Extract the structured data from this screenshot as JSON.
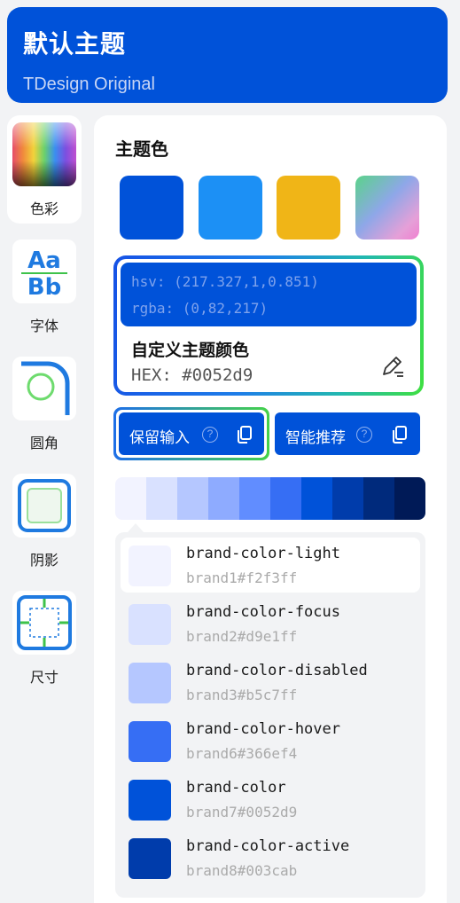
{
  "header": {
    "title": "默认主题",
    "subtitle": "TDesign Original"
  },
  "sidebar": {
    "items": [
      {
        "label": "色彩",
        "icon": "color-palette-icon",
        "active": true
      },
      {
        "label": "字体",
        "icon": "font-aa-bb-icon",
        "active": false
      },
      {
        "label": "圆角",
        "icon": "corner-radius-icon",
        "active": false
      },
      {
        "label": "阴影",
        "icon": "shadow-icon",
        "active": false
      },
      {
        "label": "尺寸",
        "icon": "size-icon",
        "active": false
      }
    ]
  },
  "main": {
    "section_title": "主题色",
    "preset_swatches": [
      {
        "name": "blue",
        "color": "#0052d9"
      },
      {
        "name": "sky-blue",
        "color": "#1c90f5"
      },
      {
        "name": "yellow",
        "color": "#f0b517"
      },
      {
        "name": "gradient",
        "color": "gradient"
      }
    ],
    "custom": {
      "hsv": "hsv: (217.327,1,0.851)",
      "rgba": "rgba: (0,82,217)",
      "name": "自定义主题颜色",
      "hex": "HEX: #0052d9"
    },
    "buttons": {
      "keep_input": "保留输入",
      "smart_recommend": "智能推荐",
      "help_glyph": "?"
    },
    "palette": [
      "#f2f3ff",
      "#d9e1ff",
      "#b5c7ff",
      "#8eabff",
      "#618dff",
      "#366ef4",
      "#0052d9",
      "#003cab",
      "#002a7c",
      "#001a57"
    ],
    "tokens": [
      {
        "name": "brand-color-light",
        "value": "brand1#f2f3ff",
        "color": "#f2f3ff"
      },
      {
        "name": "brand-color-focus",
        "value": "brand2#d9e1ff",
        "color": "#d9e1ff"
      },
      {
        "name": "brand-color-disabled",
        "value": "brand3#b5c7ff",
        "color": "#b5c7ff"
      },
      {
        "name": "brand-color-hover",
        "value": "brand6#366ef4",
        "color": "#366ef4"
      },
      {
        "name": "brand-color",
        "value": "brand7#0052d9",
        "color": "#0052d9"
      },
      {
        "name": "brand-color-active",
        "value": "brand8#003cab",
        "color": "#003cab"
      }
    ]
  }
}
